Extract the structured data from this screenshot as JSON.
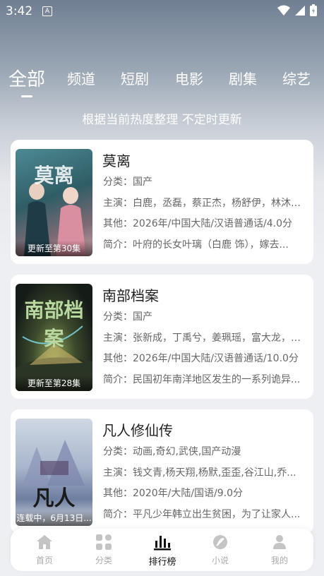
{
  "status": {
    "time": "3:42",
    "indicator": "A"
  },
  "tabs": [
    "全部",
    "频道",
    "短剧",
    "电影",
    "剧集",
    "综艺"
  ],
  "subtitle": "根据当前热度整理 不定时更新",
  "items": [
    {
      "title": "莫离",
      "poster_text": "莫离",
      "poster_caption": "更新至第30集",
      "genre": "分类：国产",
      "cast": "主演：白鹿，丞磊，蔡正杰，杨舒伊，林沐然...",
      "other": "其他：2026年/中国大陆/汉语普通话/4.0分",
      "synopsis": "简介：叶府的长女叶璃（白鹿 饰），嫁去..."
    },
    {
      "title": "南部档案",
      "poster_text": "南部档案",
      "poster_caption": "更新至第28集",
      "genre": "分类：国产",
      "cast": "主演：张新成，丁禹兮，姜珮瑶，富大龙，刘...",
      "other": "其他：2026年/中国大陆/汉语普通话/10.0分",
      "synopsis": "简介：民国初年南洋地区发生的一系列诡异..."
    },
    {
      "title": "凡人修仙传",
      "poster_text": "凡人",
      "poster_caption": "连载中，6月13日...",
      "genre": "分类：动画,奇幻,武侠,国产动漫",
      "cast": "主演：钱文青,杨天翔,杨默,歪歪,谷江山,乔...",
      "other": "其他：2020年/大陆/国语/9.0分",
      "synopsis": "简介：平凡少年韩立出生贫困，为了让家人..."
    }
  ],
  "nav": [
    {
      "label": "首页",
      "icon": "home-icon"
    },
    {
      "label": "分类",
      "icon": "category-icon"
    },
    {
      "label": "排行榜",
      "icon": "ranking-icon"
    },
    {
      "label": "小说",
      "icon": "novel-icon"
    },
    {
      "label": "我的",
      "icon": "profile-icon"
    }
  ],
  "colors": {
    "active_nav": "#111111",
    "inactive_nav": "#aaaaaa",
    "card_bg": "#ffffff"
  }
}
